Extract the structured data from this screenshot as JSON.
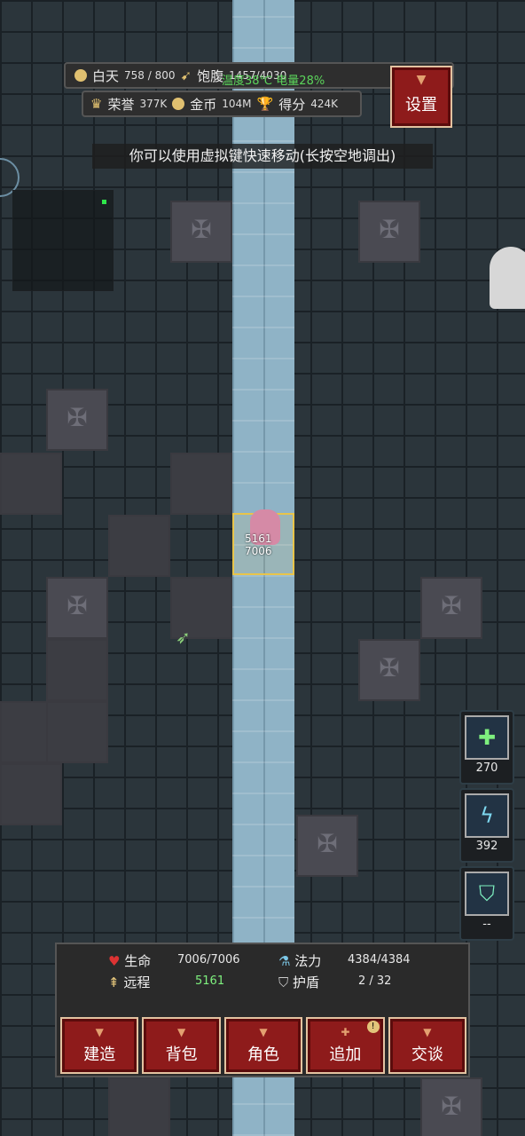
{
  "hud": {
    "time_label": "白天",
    "time_value": "758 / 800",
    "hunger_label": "饱腹",
    "hunger_value": "1457/4030",
    "temperature": "温度38℃",
    "battery": "电量28%",
    "honor_label": "荣誉",
    "honor_value": "377K",
    "gold_label": "金币",
    "gold_value": "104M",
    "score_label": "得分",
    "score_value": "424K",
    "settings_label": "设置"
  },
  "hint": "你可以使用虚拟键快速移动(长按空地调出)",
  "hero": {
    "ranged": "5161",
    "hp": "7006"
  },
  "skills": [
    {
      "name": "cross-skill",
      "mp": "270"
    },
    {
      "name": "lightning-skill",
      "mp": "392"
    },
    {
      "name": "shield-skill",
      "mp": "--"
    }
  ],
  "stats": {
    "hp_label": "生命",
    "hp_value": "7006/7006",
    "mp_label": "法力",
    "mp_value": "4384/4384",
    "ranged_label": "远程",
    "ranged_value": "5161",
    "shield_label": "护盾",
    "shield_value": "2 / 32"
  },
  "buttons": {
    "build": "建造",
    "bag": "背包",
    "character": "角色",
    "add": "追加",
    "talk": "交谈",
    "add_badge": "!"
  },
  "colors": {
    "accent_red": "#8e1b1b",
    "hp_green": "#2ee64a",
    "gold": "#e0c070"
  }
}
